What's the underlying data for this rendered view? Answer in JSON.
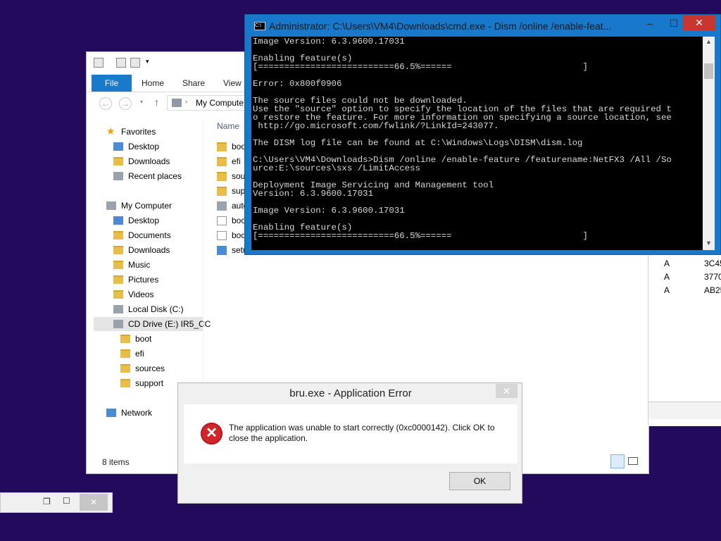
{
  "explorer": {
    "ribbon_tabs": {
      "file": "File",
      "home": "Home",
      "share": "Share",
      "view": "View"
    },
    "address": "My Compute",
    "nav_pane": {
      "favorites": "Favorites",
      "fav_items": [
        "Desktop",
        "Downloads",
        "Recent places"
      ],
      "my_computer": "My Computer",
      "pc_items": [
        "Desktop",
        "Documents",
        "Downloads",
        "Music",
        "Pictures",
        "Videos",
        "Local Disk (C:)",
        "CD Drive (E:) IR5_CC"
      ],
      "cd_items": [
        "boot",
        "efi",
        "sources",
        "support"
      ],
      "network": "Network"
    },
    "column_name": "Name",
    "files": [
      "boo",
      "efi",
      "sou",
      "sup",
      "auto",
      "boo",
      "boo",
      "setu"
    ],
    "status": "8 items"
  },
  "bg_window": {
    "rows": [
      {
        "attr": "A",
        "value": "3C45"
      },
      {
        "attr": "A",
        "value": "3770"
      },
      {
        "attr": "A",
        "value": "AB25"
      }
    ]
  },
  "cmd": {
    "title": "Administrator: C:\\Users\\VM4\\Downloads\\cmd.exe - Dism  /online /enable-feat...",
    "minimize": "–",
    "maximize": "☐",
    "close": "✕",
    "lines": [
      "Image Version: 6.3.9600.17031",
      "",
      "Enabling feature(s)",
      "[==========================66.5%======                         ]",
      "",
      "Error: 0x800f0906",
      "",
      "The source files could not be downloaded.",
      "Use the \"source\" option to specify the location of the files that are required t",
      "o restore the feature. For more information on specifying a source location, see",
      " http://go.microsoft.com/fwlink/?LinkId=243077.",
      "",
      "The DISM log file can be found at C:\\Windows\\Logs\\DISM\\dism.log",
      "",
      "C:\\Users\\VM4\\Downloads>Dism /online /enable-feature /featurename:NetFX3 /All /So",
      "urce:E:\\sources\\sxs /LimitAccess",
      "",
      "Deployment Image Servicing and Management tool",
      "Version: 6.3.9600.17031",
      "",
      "Image Version: 6.3.9600.17031",
      "",
      "Enabling feature(s)",
      "[==========================66.5%======                         ]"
    ]
  },
  "dialog": {
    "title": "bru.exe - Application Error",
    "close": "✕",
    "message": "The application was unable to start correctly (0xc0000142). Click OK to close the application.",
    "icon": "✕",
    "ok": "OK"
  },
  "minimized": {
    "restore": "❐",
    "maximize": "☐",
    "close": "✕"
  }
}
